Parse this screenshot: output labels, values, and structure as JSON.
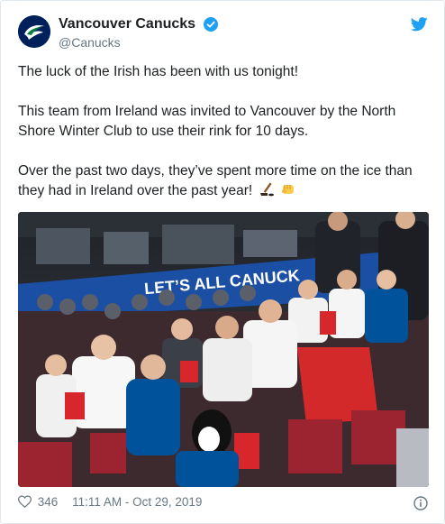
{
  "tweet": {
    "display_name": "Vancouver Canucks",
    "handle": "@Canucks",
    "paragraphs": [
      "The luck of the Irish has been with us tonight!",
      "This team from Ireland was invited to Vancouver by the North Shore Winter Club to use their rink for 10 days.",
      "Over the past two days, they’ve spent more time on the ice than they had in Ireland over the past year!"
    ],
    "emojis": [
      "hockey-stick-icon",
      "fist-bump-icon"
    ],
    "banner_text": "LET’S ALL CANUCK",
    "likes": "346",
    "timestamp": "11:11 AM - Oct 29, 2019"
  },
  "colors": {
    "twitter_blue": "#1da1f2",
    "canucks_navy": "#00205b",
    "canucks_green": "#00843d",
    "canucks_blue": "#00539b",
    "muted_text": "#697882"
  }
}
